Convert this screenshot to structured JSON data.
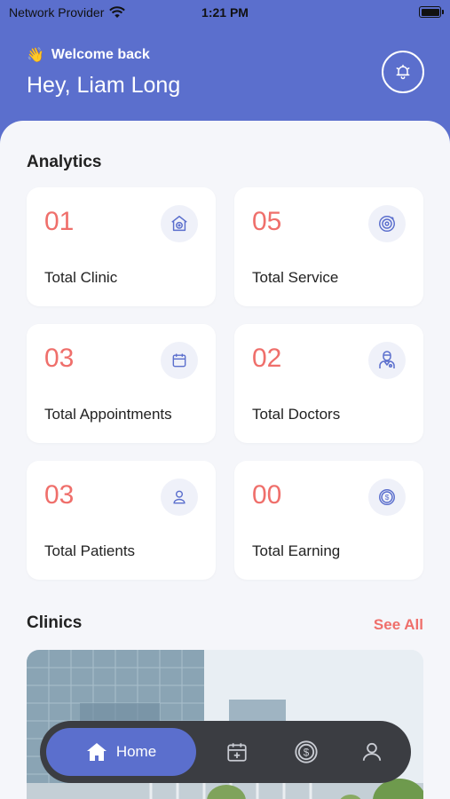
{
  "status_bar": {
    "carrier": "Network Provider",
    "time": "1:21 PM"
  },
  "header": {
    "welcome": "Welcome back",
    "greeting": "Hey, Liam Long",
    "wave_icon": "waving-hand-icon",
    "bell_icon": "bell-icon"
  },
  "analytics": {
    "title": "Analytics",
    "cards": [
      {
        "value": "01",
        "label": "Total Clinic",
        "icon": "clinic-icon"
      },
      {
        "value": "05",
        "label": "Total Service",
        "icon": "service-icon"
      },
      {
        "value": "03",
        "label": "Total Appointments",
        "icon": "calendar-icon"
      },
      {
        "value": "02",
        "label": "Total Doctors",
        "icon": "doctor-icon"
      },
      {
        "value": "03",
        "label": "Total Patients",
        "icon": "user-icon"
      },
      {
        "value": "00",
        "label": "Total Earning",
        "icon": "dollar-coin-icon"
      }
    ]
  },
  "clinics": {
    "title": "Clinics",
    "see_all": "See All"
  },
  "tabbar": {
    "home_label": "Home",
    "tabs": [
      "home-icon",
      "calendar-plus-icon",
      "dollar-coin-icon",
      "profile-icon"
    ]
  },
  "colors": {
    "primary": "#5b6fcd",
    "accent": "#ef6f6b",
    "background": "#f5f6fa",
    "tabbar": "#3b3d42"
  }
}
